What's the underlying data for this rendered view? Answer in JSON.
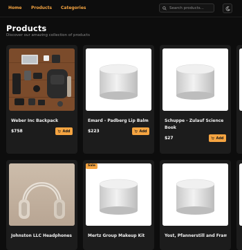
{
  "nav": {
    "links": [
      "Home",
      "Products",
      "Categories"
    ],
    "search_placeholder": "Search products...",
    "accent_color": "#f5a441"
  },
  "page": {
    "title": "Products",
    "subtitle": "Discover our amazing collection of products"
  },
  "add_label": "Add",
  "products": [
    {
      "name": "Weber Inc Backpack",
      "price": "$758",
      "image": "backpack-flatlay-photo",
      "badge": ""
    },
    {
      "name": "Emard - Padberg Lip Balm",
      "price": "$223",
      "image": "white-container-photo",
      "badge": ""
    },
    {
      "name": "Schuppe - Zulauf Science Book",
      "price": "$27",
      "image": "white-container-photo",
      "badge": ""
    },
    {
      "name": "Johnston LLC Headphones",
      "price": "",
      "image": "headphones-photo",
      "badge": ""
    },
    {
      "name": "Mertz Group Makeup Kit",
      "price": "",
      "image": "white-container-photo",
      "badge": "Sale"
    },
    {
      "name": "Yost, Pfannerstill and Framl",
      "price": "",
      "image": "white-container-photo",
      "badge": ""
    }
  ]
}
